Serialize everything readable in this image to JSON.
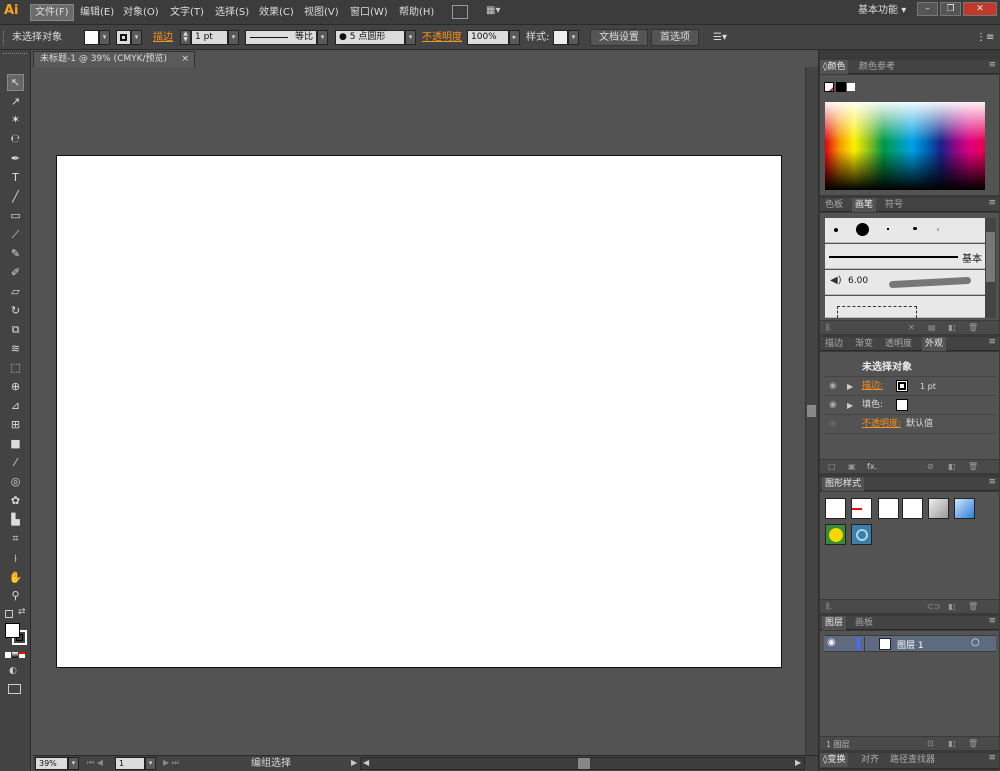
{
  "app": {
    "logo": "Ai"
  },
  "menu": [
    {
      "label": "文件(F)",
      "active": true
    },
    {
      "label": "编辑(E)"
    },
    {
      "label": "对象(O)"
    },
    {
      "label": "文字(T)"
    },
    {
      "label": "选择(S)"
    },
    {
      "label": "效果(C)"
    },
    {
      "label": "视图(V)"
    },
    {
      "label": "窗口(W)"
    },
    {
      "label": "帮助(H)"
    }
  ],
  "workspace": {
    "label": "基本功能"
  },
  "window_controls": {
    "minimize": "–",
    "restore": "❐",
    "close": "✕"
  },
  "control_bar": {
    "selection_status": "未选择对象",
    "stroke_label": "描边",
    "stroke_weight": "1 pt",
    "stroke_profile": "等比",
    "brush_def": "5 点圆形",
    "opacity_label": "不透明度",
    "opacity_value": "100%",
    "style_label": "样式:",
    "doc_setup_button": "文档设置",
    "prefs_button": "首选项"
  },
  "document": {
    "tab_title": "未标题-1 @ 39% (CMYK/预览)",
    "close": "×"
  },
  "status_bar": {
    "zoom": "39%",
    "artboard_num": "1",
    "tool_status": "编组选择"
  },
  "panels": {
    "color": {
      "tabs": [
        "颜色",
        "颜色参考"
      ]
    },
    "brushes": {
      "tabs": [
        "色板",
        "画笔",
        "符号"
      ],
      "basic_label": "基本",
      "size_label": "6.00"
    },
    "appearance": {
      "tabs": [
        "描边",
        "渐变",
        "透明度",
        "外观"
      ],
      "title": "未选择对象",
      "stroke_label": "描边:",
      "stroke_value": "1 pt",
      "fill_label": "填色:",
      "opacity_label": "不透明度:",
      "opacity_value": "默认值",
      "fx_label": "fx."
    },
    "graphic_styles": {
      "tabs": [
        "图形样式"
      ]
    },
    "layers": {
      "tabs": [
        "图层",
        "画板"
      ],
      "layer_name": "图层 1",
      "footer_text": "1 图层"
    },
    "bottom": {
      "tabs": [
        "变换",
        "对齐",
        "路径查找器"
      ]
    }
  },
  "colors": {
    "accent": "#f7931e",
    "artboard": "#ffffff",
    "ui_bg": "#535353",
    "layer_highlight": "#4a6a9c"
  }
}
